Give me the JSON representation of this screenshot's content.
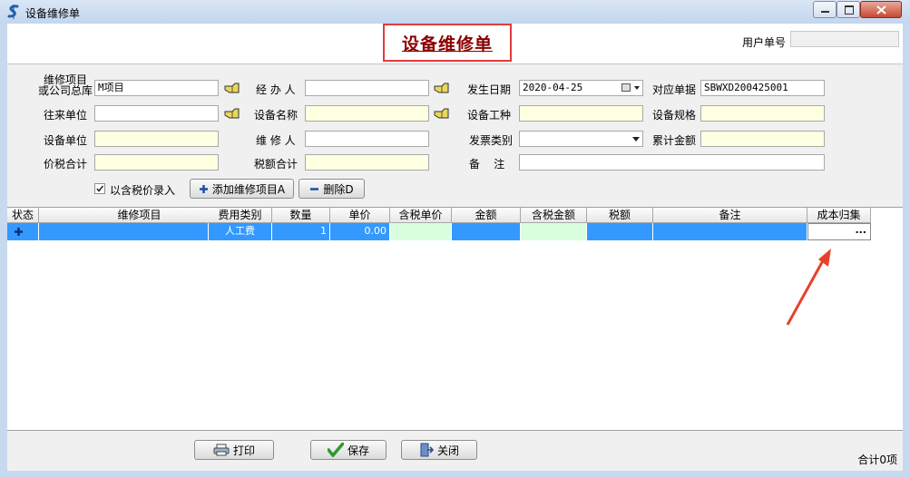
{
  "window": {
    "title": "设备维修单"
  },
  "form_title": "设备维修单",
  "user_doc_no": {
    "label": "用户单号",
    "value": ""
  },
  "fields": {
    "repair_item": {
      "label_line1": "维修项目",
      "label_line2": "或公司总库",
      "value": "M项目"
    },
    "handler": {
      "label": "经 办 人",
      "value": ""
    },
    "date": {
      "label": "发生日期",
      "value": "2020-04-25"
    },
    "ref_doc": {
      "label": "对应单据",
      "value": "SBWXD200425001"
    },
    "partner": {
      "label": "往来单位",
      "value": ""
    },
    "device_name": {
      "label": "设备名称",
      "value": ""
    },
    "device_type": {
      "label": "设备工种",
      "value": ""
    },
    "device_spec": {
      "label": "设备规格",
      "value": ""
    },
    "device_unit": {
      "label": "设备单位",
      "value": ""
    },
    "repairer": {
      "label": "维 修 人",
      "value": ""
    },
    "invoice_type": {
      "label": "发票类别",
      "value": ""
    },
    "total_amount": {
      "label": "累计金额",
      "value": ""
    },
    "total_incl_tax": {
      "label": "价税合计",
      "value": ""
    },
    "tax_total": {
      "label": "税额合计",
      "value": ""
    },
    "remark": {
      "label": "备    注",
      "value": ""
    }
  },
  "tax_entry": {
    "label": "以含税价录入",
    "checked": true
  },
  "buttons": {
    "add_item": "添加维修项目A",
    "delete": "删除D",
    "print": "打印",
    "save": "保存",
    "close": "关闭"
  },
  "grid": {
    "columns": [
      "状态",
      "维修项目",
      "费用类别",
      "数量",
      "单价",
      "含税单价",
      "金额",
      "含税金额",
      "税额",
      "备注",
      "成本归集"
    ],
    "rows": [
      {
        "status_icon": "plus-icon",
        "repair_item": "",
        "fee_type": "人工费",
        "qty": "1",
        "price": "0.00",
        "price_incl_tax": "",
        "amount": "",
        "amount_incl_tax": "",
        "tax": "",
        "note": "",
        "cost_center": "..."
      }
    ]
  },
  "summary": {
    "count_text": "合计0项"
  },
  "colors": {
    "selection": "#3399ff",
    "title_text": "#8b0000",
    "highlight_box": "#e23b3b",
    "yellow_field": "#ffffe1",
    "mint_cell": "#d9ffe0"
  }
}
